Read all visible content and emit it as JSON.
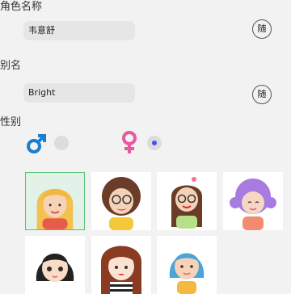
{
  "role_name": {
    "label": "角色名称",
    "value": "韦意舒",
    "random_label": "随"
  },
  "alias": {
    "label": "别名",
    "value": "Bright",
    "random_label": "随"
  },
  "gender": {
    "label": "性别",
    "options": [
      {
        "icon": "male-symbol-icon",
        "color": "#1a7fd0",
        "selected": false
      },
      {
        "icon": "female-symbol-icon",
        "color": "#e35aa0",
        "selected": true
      }
    ]
  },
  "avatars": [
    {
      "id": "avatar-blonde-girl",
      "selected": true
    },
    {
      "id": "avatar-glasses-curly-girl",
      "selected": false
    },
    {
      "id": "avatar-glasses-bun-girl",
      "selected": false
    },
    {
      "id": "avatar-purple-hair-girl",
      "selected": false
    },
    {
      "id": "avatar-black-bob-girl",
      "selected": false
    },
    {
      "id": "avatar-bangs-girl",
      "selected": false
    },
    {
      "id": "avatar-blue-hair-girl",
      "selected": false
    }
  ]
}
